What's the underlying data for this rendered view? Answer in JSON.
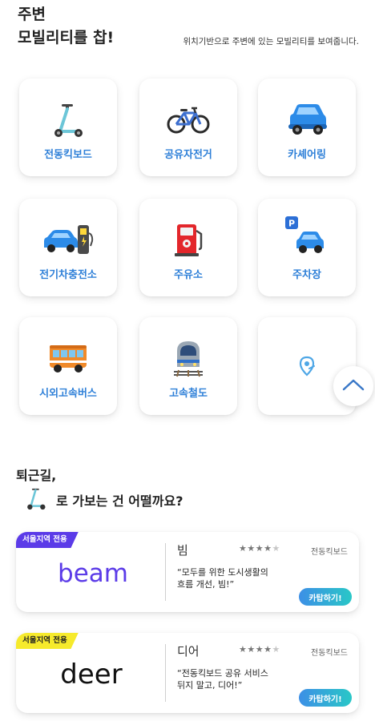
{
  "header": {
    "title_line1": "주변",
    "title_line2": "모빌리티를 찹!",
    "subtitle": "위치기반으로 주변에 있는 모빌리티를 보여줍니다."
  },
  "categories": [
    {
      "label": "전동킥보드",
      "icon": "kick-scooter-icon"
    },
    {
      "label": "공유자전거",
      "icon": "bicycle-icon"
    },
    {
      "label": "카셰어링",
      "icon": "blue-car-icon"
    },
    {
      "label": "전기차충전소",
      "icon": "ev-charging-icon"
    },
    {
      "label": "주유소",
      "icon": "fuel-pump-icon"
    },
    {
      "label": "주차장",
      "icon": "parking-icon"
    },
    {
      "label": "시외고속버스",
      "icon": "bus-icon"
    },
    {
      "label": "고속철도",
      "icon": "train-icon"
    },
    {
      "label": "",
      "icon": "location-pin-icon"
    }
  ],
  "recommend": {
    "heading": "퇴근길,",
    "line2": "로 가보는 건 어떨까요?",
    "icon": "kick-scooter-icon"
  },
  "colors": {
    "accent": "#2f80d8",
    "beam_badge": "#5b3be8",
    "deer_badge": "#f6ea2c",
    "cta_from": "#3d8fe6",
    "cta_to": "#29c7c7"
  },
  "services": [
    {
      "badge": "서울지역 전용",
      "logo": "beam",
      "name": "빔",
      "stars": 4,
      "stars_max": 5,
      "type": "전동킥보드",
      "desc_line1": "“모두를 위한 도시생활의",
      "desc_line2": "흐름 개선, 빔!”",
      "cta": "카탑하기!"
    },
    {
      "badge": "서울지역 전용",
      "logo": "deer",
      "name": "디어",
      "stars": 4,
      "stars_max": 5,
      "type": "전동킥보드",
      "desc_line1": "“전동킥보드 공유 서비스",
      "desc_line2": "뒤지 말고, 디어!”",
      "cta": "카탑하기!"
    }
  ]
}
